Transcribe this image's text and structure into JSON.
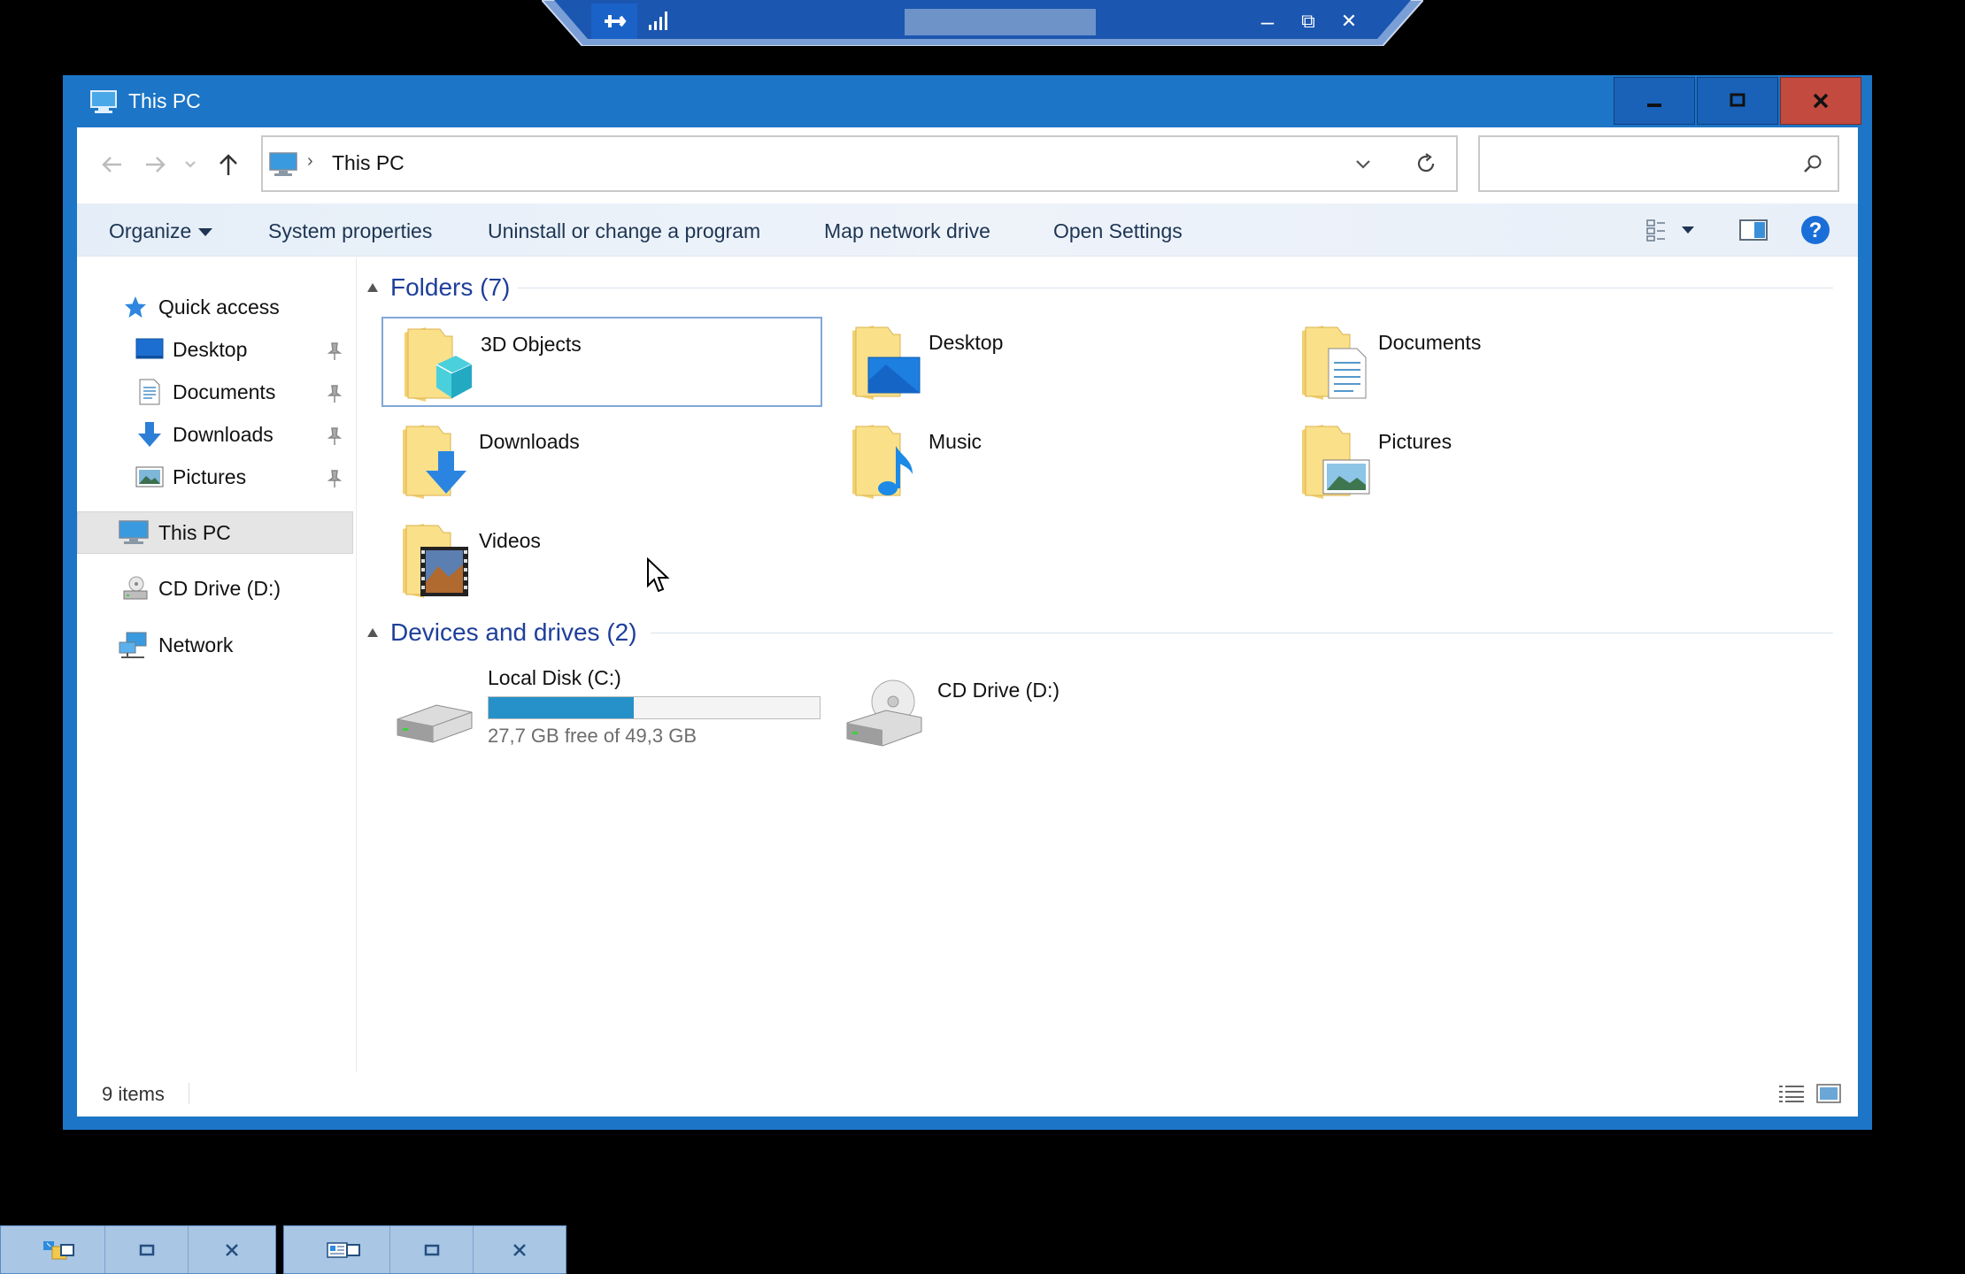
{
  "rdp_bar": {
    "pin_icon": "pin-icon",
    "signal_icon": "connection-quality-icon",
    "minimize_glyph": "–",
    "restore_glyph": "⧉",
    "close_glyph": "✕"
  },
  "window": {
    "title": "This PC",
    "title_icon": "this-pc-icon",
    "accent": "#1c75c6",
    "close_color": "#c24a3f"
  },
  "address": {
    "path": "This PC",
    "separator": "›",
    "search_placeholder": ""
  },
  "commands": {
    "organize": "Organize",
    "system_properties": "System properties",
    "uninstall": "Uninstall or change a program",
    "map_drive": "Map network drive",
    "open_settings": "Open Settings"
  },
  "nav": {
    "quick_access": "Quick access",
    "desktop": "Desktop",
    "documents": "Documents",
    "downloads": "Downloads",
    "pictures": "Pictures",
    "this_pc": "This PC",
    "cd_drive": "CD Drive (D:)",
    "network": "Network"
  },
  "groups": {
    "folders": "Folders (7)",
    "devices": "Devices and drives (2)"
  },
  "folders": {
    "objects3d": "3D Objects",
    "desktop": "Desktop",
    "documents": "Documents",
    "downloads": "Downloads",
    "music": "Music",
    "pictures": "Pictures",
    "videos": "Videos"
  },
  "drives": {
    "local_disk": {
      "label": "Local Disk (C:)",
      "free_text": "27,7 GB free of 49,3 GB",
      "used_fraction": 0.438
    },
    "cd_drive": {
      "label": "CD Drive (D:)"
    }
  },
  "status": {
    "items": "9 items"
  }
}
